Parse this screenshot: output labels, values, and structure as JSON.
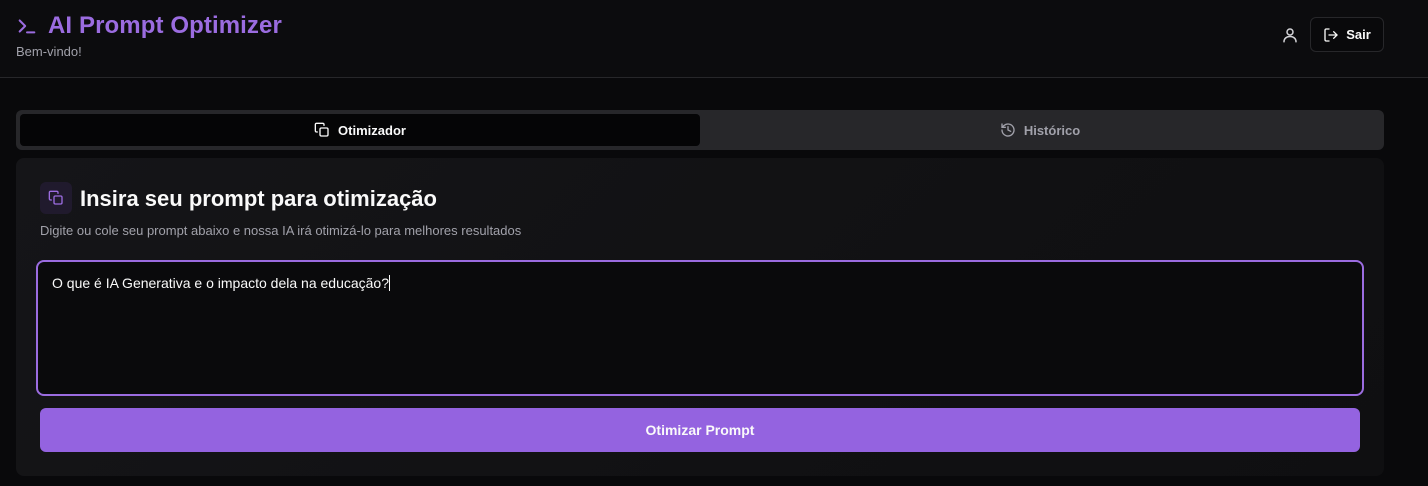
{
  "header": {
    "title": "AI Prompt Optimizer",
    "subtitle": "Bem-vindo!",
    "logout_label": "Sair",
    "brand_icon": "terminal-icon",
    "user_icon": "user-icon"
  },
  "tabs": [
    {
      "label": "Otimizador",
      "icon": "copy-icon",
      "active": true
    },
    {
      "label": "Histórico",
      "icon": "history-icon",
      "active": false
    }
  ],
  "card": {
    "title": "Insira seu prompt para otimização",
    "description": "Digite ou cole seu prompt abaixo e nossa IA irá otimizá-lo para melhores resultados",
    "prompt_value": "O que é IA Generativa e o impacto dela na educação?",
    "button_label": "Otimizar Prompt"
  },
  "colors": {
    "accent": "#9b6ce0",
    "button": "#9463e0",
    "background": "#09090b"
  }
}
